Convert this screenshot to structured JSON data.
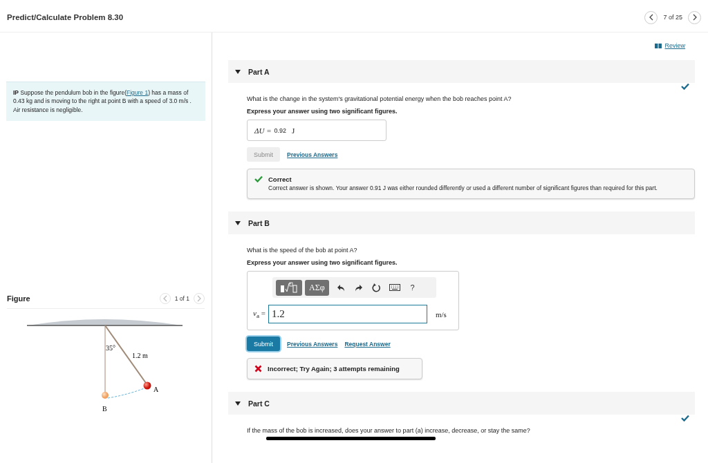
{
  "header": {
    "title": "Predict/Calculate Problem 8.30",
    "pager": "7 of 25"
  },
  "review_link": "Review",
  "problem": {
    "before": "**IP** Suppose the pendulum bob in the figure(",
    "link": "Figure 1",
    "after": ") has a mass of 0.43 kg and is moving to the right at point B with a speed of 3.0 m/s . Air resistance is negligible."
  },
  "figure": {
    "title": "Figure",
    "pager": "1 of 1",
    "angle": "35°",
    "length": "1.2 m",
    "point_a": "A",
    "point_b": "B"
  },
  "parts": [
    {
      "title": "Part A",
      "expanded": true,
      "completed": true,
      "kind": "simple",
      "question": "What is the change in the system's gravitational potential energy when the bob reaches point A?",
      "instruction": "Express your answer using two significant figures.",
      "answer": {
        "variable": "ΔU =",
        "value": "0.92",
        "unit": "J"
      },
      "submit": {
        "label": "Submit",
        "disabled": true
      },
      "links": [
        "Previous Answers"
      ],
      "feedback": {
        "kind": "correct",
        "title": "Correct",
        "message": "Correct answer is shown. Your answer 0.91 J was either rounded differently or used a different number of significant figures than required for this part."
      }
    },
    {
      "title": "Part B",
      "expanded": true,
      "completed": false,
      "kind": "editor",
      "question": "What is the speed of the bob at point A?",
      "instruction": "Express your answer using two significant figures.",
      "toolbar": {
        "symbols": "ΑΣφ",
        "help": "?"
      },
      "answer": {
        "variable": "*v*$_{a}$ =",
        "value": "1.2",
        "unit": "m/s"
      },
      "submit": {
        "label": "Submit",
        "disabled": false
      },
      "links": [
        "Previous Answers",
        "Request Answer"
      ],
      "feedback": {
        "kind": "incorrect",
        "message": "Incorrect; Try Again; 3 attempts remaining"
      }
    },
    {
      "title": "Part C",
      "expanded": true,
      "completed": true,
      "kind": "question_only",
      "question": "If the mass of the bob is increased, does your answer to part (a) increase, decrease, or stay the same?"
    }
  ]
}
